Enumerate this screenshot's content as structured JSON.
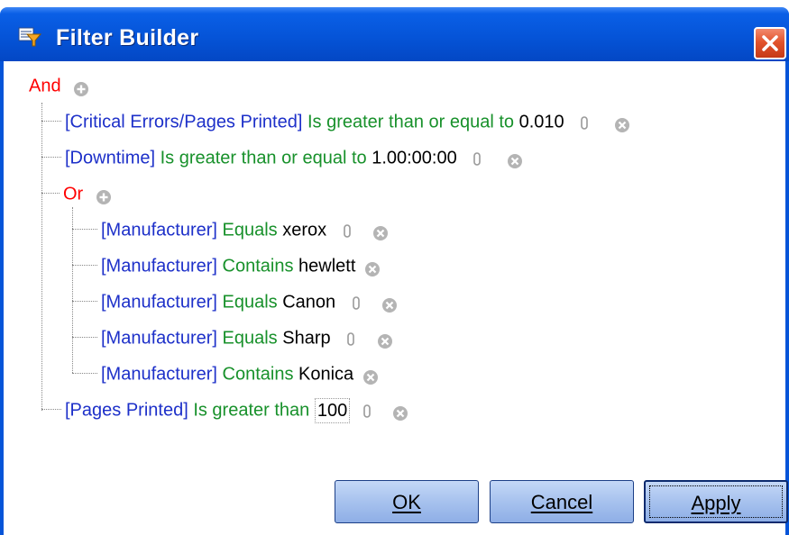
{
  "window": {
    "title": "Filter Builder",
    "accent": "#0554d8",
    "close_color": "#e2542d"
  },
  "colors": {
    "field": "#1d30c9",
    "operator": "#18912b",
    "group": "#ff0000",
    "value": "#000000"
  },
  "tree": {
    "root_group": "And",
    "rows": [
      {
        "field": "[Critical Errors/Pages Printed]",
        "operator": "Is greater than or equal to",
        "value": "0.010"
      },
      {
        "field": "[Downtime]",
        "operator": "Is greater than or equal to",
        "value": "1.00:00:00"
      },
      {
        "group": "Or"
      },
      {
        "field": "[Manufacturer]",
        "operator": "Equals",
        "value": "xerox"
      },
      {
        "field": "[Manufacturer]",
        "operator": "Contains",
        "value": "hewlett"
      },
      {
        "field": "[Manufacturer]",
        "operator": "Equals",
        "value": "Canon"
      },
      {
        "field": "[Manufacturer]",
        "operator": "Equals",
        "value": "Sharp"
      },
      {
        "field": "[Manufacturer]",
        "operator": "Contains",
        "value": "Konica"
      },
      {
        "field": "[Pages Printed]",
        "operator": "Is greater than",
        "value": "100"
      }
    ]
  },
  "buttons": {
    "ok": "OK",
    "cancel": "Cancel",
    "apply": "Apply"
  },
  "icons": {
    "add": "plus-circle",
    "remove": "x-circle",
    "value_editor": "clip",
    "title": "filter-funnel",
    "close": "close-x"
  }
}
